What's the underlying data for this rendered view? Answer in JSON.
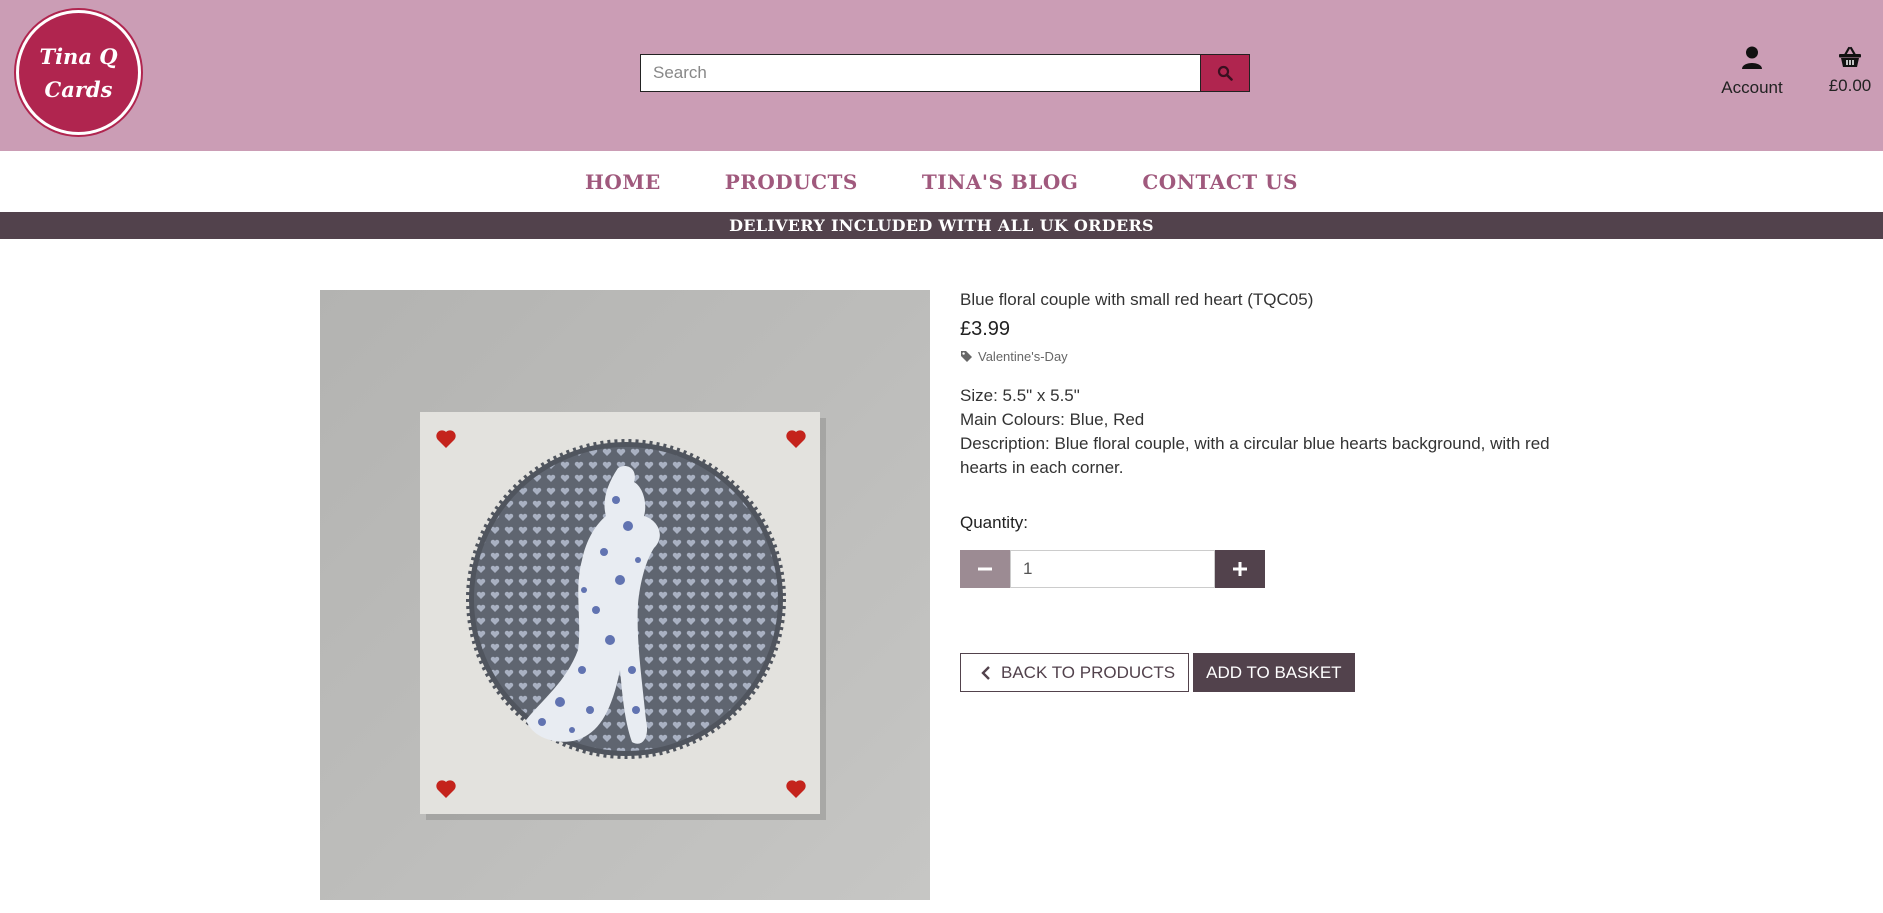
{
  "header": {
    "logo_text": "Tina Q Cards",
    "search": {
      "placeholder": "Search",
      "value": ""
    },
    "account_label": "Account",
    "basket_total": "£0.00",
    "background_color": "#cb9db5",
    "brand_color": "#b0254f"
  },
  "nav": {
    "items": [
      {
        "label": "HOME"
      },
      {
        "label": "PRODUCTS"
      },
      {
        "label": "TINA'S BLOG"
      },
      {
        "label": "CONTACT US"
      }
    ],
    "color": "#a0597d"
  },
  "banner": {
    "text": "DELIVERY INCLUDED WITH ALL UK ORDERS",
    "color": "#52424c"
  },
  "product": {
    "title": "Blue floral couple with small red heart (TQC05)",
    "price": "£3.99",
    "category": "Valentine's-Day",
    "size": "Size: 5.5\" x 5.5\"",
    "colours": "Main Colours: Blue, Red",
    "description": "Description: Blue floral couple, with a circular blue hearts background, with red hearts in each corner.",
    "quantity_label": "Quantity:",
    "quantity_value": "1",
    "back_label": "BACK TO PRODUCTS",
    "add_label": "ADD TO BASKET"
  },
  "icons": [
    "search-icon",
    "user-icon",
    "basket-icon",
    "tag-icon",
    "minus-icon",
    "plus-icon",
    "chevron-left-icon"
  ]
}
